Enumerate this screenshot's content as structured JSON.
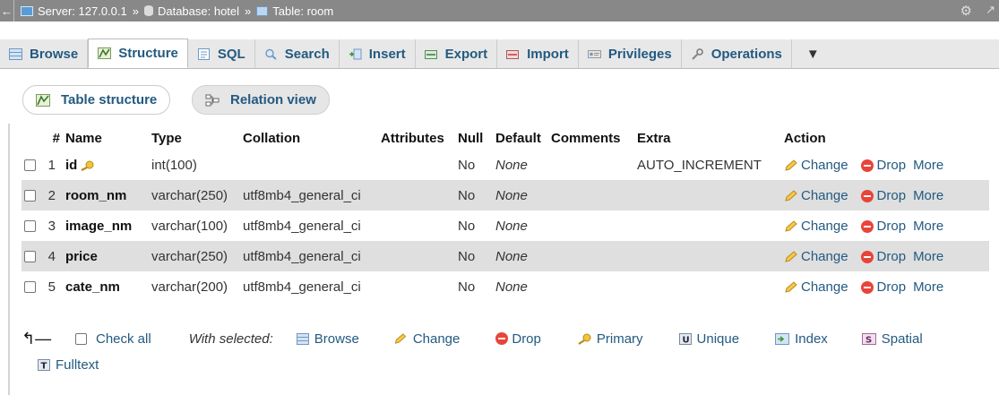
{
  "breadcrumb": {
    "server": "Server: 127.0.0.1",
    "database": "Database: hotel",
    "table": "Table: room",
    "separator": "»"
  },
  "tabs": [
    {
      "label": "Browse",
      "icon": "browse-icon"
    },
    {
      "label": "Structure",
      "icon": "structure-icon",
      "active": true
    },
    {
      "label": "SQL",
      "icon": "sql-icon"
    },
    {
      "label": "Search",
      "icon": "search-icon"
    },
    {
      "label": "Insert",
      "icon": "insert-icon"
    },
    {
      "label": "Export",
      "icon": "export-icon"
    },
    {
      "label": "Import",
      "icon": "import-icon"
    },
    {
      "label": "Privileges",
      "icon": "privileges-icon"
    },
    {
      "label": "Operations",
      "icon": "operations-icon"
    }
  ],
  "subtabs": {
    "table_structure": "Table structure",
    "relation_view": "Relation view"
  },
  "columns_header": {
    "num": "#",
    "name": "Name",
    "type": "Type",
    "collation": "Collation",
    "attributes": "Attributes",
    "null": "Null",
    "default": "Default",
    "comments": "Comments",
    "extra": "Extra",
    "action": "Action"
  },
  "rows": [
    {
      "num": "1",
      "name": "id",
      "type": "int(100)",
      "collation": "",
      "null": "No",
      "default": "None",
      "extra": "AUTO_INCREMENT",
      "primary": true
    },
    {
      "num": "2",
      "name": "room_nm",
      "type": "varchar(250)",
      "collation": "utf8mb4_general_ci",
      "null": "No",
      "default": "None",
      "extra": ""
    },
    {
      "num": "3",
      "name": "image_nm",
      "type": "varchar(100)",
      "collation": "utf8mb4_general_ci",
      "null": "No",
      "default": "None",
      "extra": ""
    },
    {
      "num": "4",
      "name": "price",
      "type": "varchar(250)",
      "collation": "utf8mb4_general_ci",
      "null": "No",
      "default": "None",
      "extra": ""
    },
    {
      "num": "5",
      "name": "cate_nm",
      "type": "varchar(200)",
      "collation": "utf8mb4_general_ci",
      "null": "No",
      "default": "None",
      "extra": ""
    }
  ],
  "row_actions": {
    "change": "Change",
    "drop": "Drop",
    "more": "More"
  },
  "bulk": {
    "check_all": "Check all",
    "with_selected": "With selected:",
    "browse": "Browse",
    "change": "Change",
    "drop": "Drop",
    "primary": "Primary",
    "unique": "Unique",
    "index": "Index",
    "spatial": "Spatial",
    "fulltext": "Fulltext"
  },
  "colors": {
    "link": "#235a81",
    "topbar": "#888888",
    "row_alt": "#dfdfdf",
    "drop_red": "#e8443a"
  }
}
